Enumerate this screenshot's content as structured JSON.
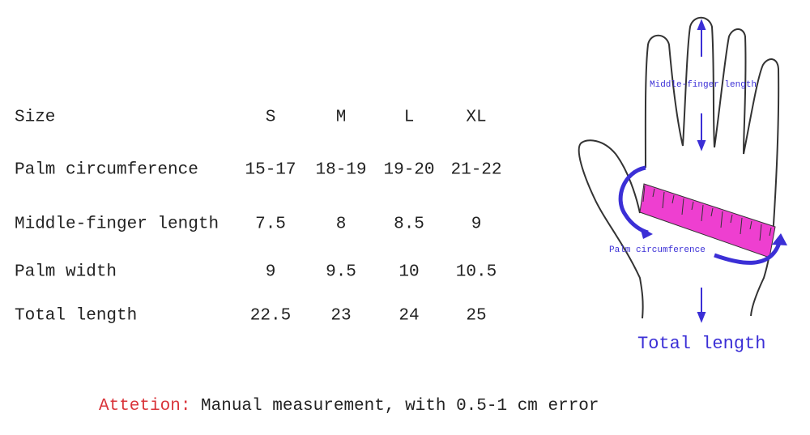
{
  "table": {
    "header": {
      "label": "Size",
      "sizes": [
        "S",
        "M",
        "L",
        "XL"
      ]
    },
    "rows": [
      {
        "label": "Palm circumference",
        "values": [
          "15-17",
          "18-19",
          "19-20",
          "21-22"
        ]
      },
      {
        "label": "Middle-finger length",
        "values": [
          "7.5",
          "8",
          "8.5",
          "9"
        ]
      },
      {
        "label": "Palm width",
        "values": [
          "9",
          "9.5",
          "10",
          "10.5"
        ]
      },
      {
        "label": "Total length",
        "values": [
          "22.5",
          "23",
          "24",
          "25"
        ]
      }
    ]
  },
  "diagram": {
    "middle_finger_label": "Middle-finger length",
    "palm_circumference_label": "Palm circumference",
    "total_length_label": "Total length",
    "colors": {
      "arrow": "#3b2fd6",
      "tape": "#ee3fd0",
      "outline": "#333333"
    }
  },
  "footer": {
    "attention": "Attetion:",
    "note": " Manual measurement, with 0.5-1 cm error"
  }
}
